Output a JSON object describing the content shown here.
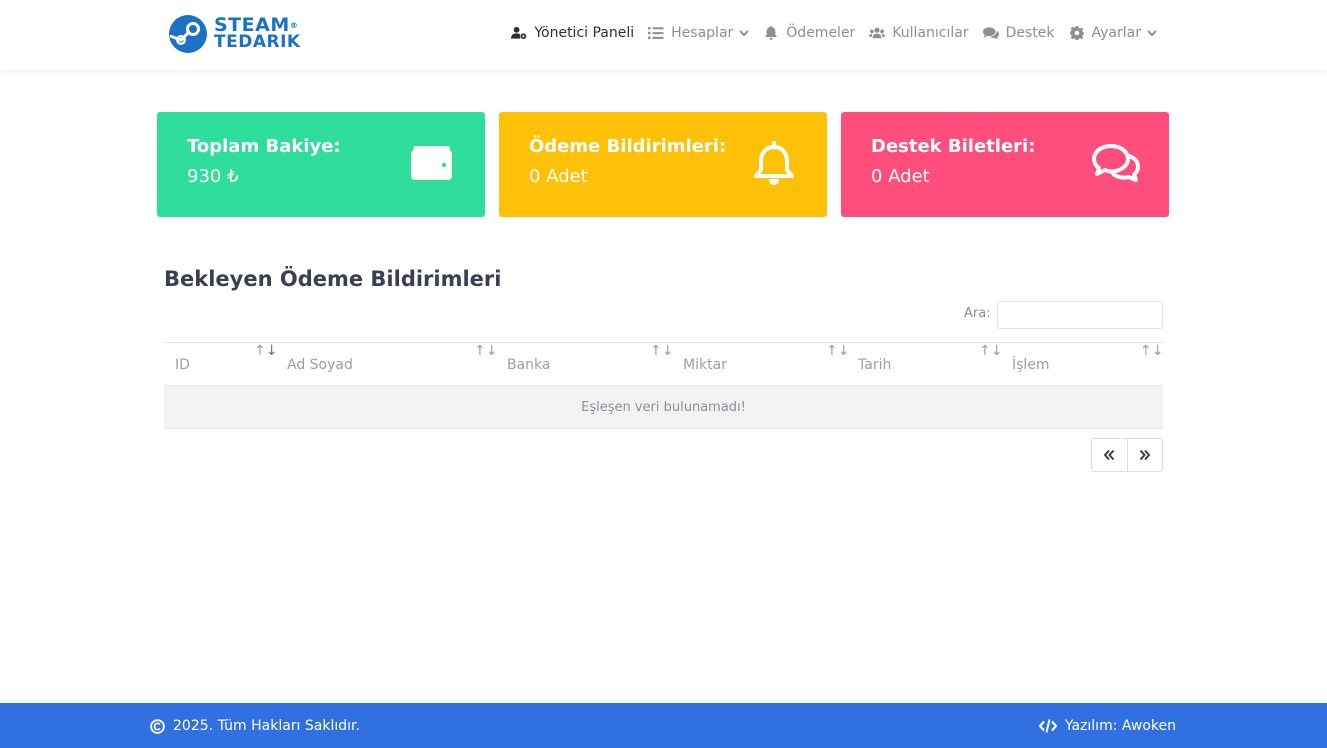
{
  "header": {
    "logo": {
      "line1": "STEAM",
      "line2": "TEDARIK",
      "reg": "®"
    },
    "nav": [
      {
        "label": "Yönetici Paneli",
        "icon": "user-gear-icon",
        "active": true
      },
      {
        "label": "Hesaplar",
        "icon": "list-icon",
        "dropdown": true
      },
      {
        "label": "Ödemeler",
        "icon": "bell-icon"
      },
      {
        "label": "Kullanıcılar",
        "icon": "users-icon"
      },
      {
        "label": "Destek",
        "icon": "comments-icon"
      },
      {
        "label": "Ayarlar",
        "icon": "gear-icon",
        "dropdown": true
      }
    ]
  },
  "cards": [
    {
      "title": "Toplam Bakiye:",
      "value": "930 ₺",
      "icon": "wallet-icon",
      "color": "#2fdd9c"
    },
    {
      "title": "Ödeme Bildirimleri:",
      "value": "0 Adet",
      "icon": "bell-icon",
      "color": "#ffc107"
    },
    {
      "title": "Destek Biletleri:",
      "value": "0 Adet",
      "icon": "comments-icon",
      "color": "#ff4e7c"
    }
  ],
  "section": {
    "title": "Bekleyen Ödeme Bildirimleri",
    "search_label": "Ara:",
    "search_value": "",
    "columns": [
      "ID",
      "Ad Soyad",
      "Banka",
      "Miktar",
      "Tarih",
      "İşlem"
    ],
    "empty_message": "Eşleşen veri bulunamadı!"
  },
  "footer": {
    "copyright": "2025. Tüm Hakları Saklıdır.",
    "credit": "Yazılım: Awoken",
    "color": "#3170e0"
  }
}
